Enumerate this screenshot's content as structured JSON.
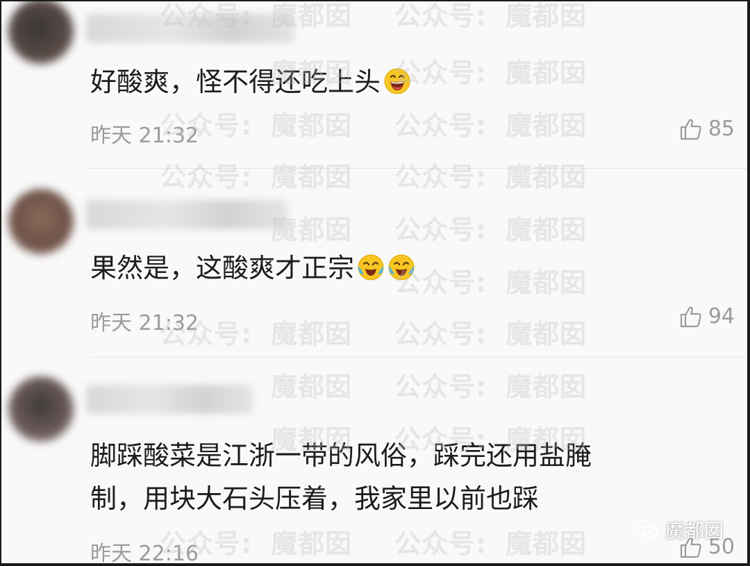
{
  "watermark": {
    "text_a": "公众号:",
    "text_b": "魔都囡"
  },
  "comments": [
    {
      "text": "好酸爽，怪不得还吃上头",
      "emoji": [
        "grinning-face-emoji"
      ],
      "time": "昨天 21:32",
      "likes": "85"
    },
    {
      "text": "果然是，这酸爽才正宗",
      "emoji": [
        "crying-laughing-emoji",
        "crying-laughing-emoji"
      ],
      "time": "昨天 21:32",
      "likes": "94"
    },
    {
      "text_line1": "脚踩酸菜是江浙一带的风俗，踩完还用盐腌",
      "text_line2": "制，用块大石头压着，我家里以前也踩",
      "time": "昨天 22:16",
      "likes": "50"
    }
  ],
  "brand": {
    "icon": "wechat-icon",
    "label": "魔都囡"
  },
  "colors": {
    "text": "#1c1c1c",
    "meta": "#9b9b9b",
    "emoji_yellow": "#f7c623"
  }
}
